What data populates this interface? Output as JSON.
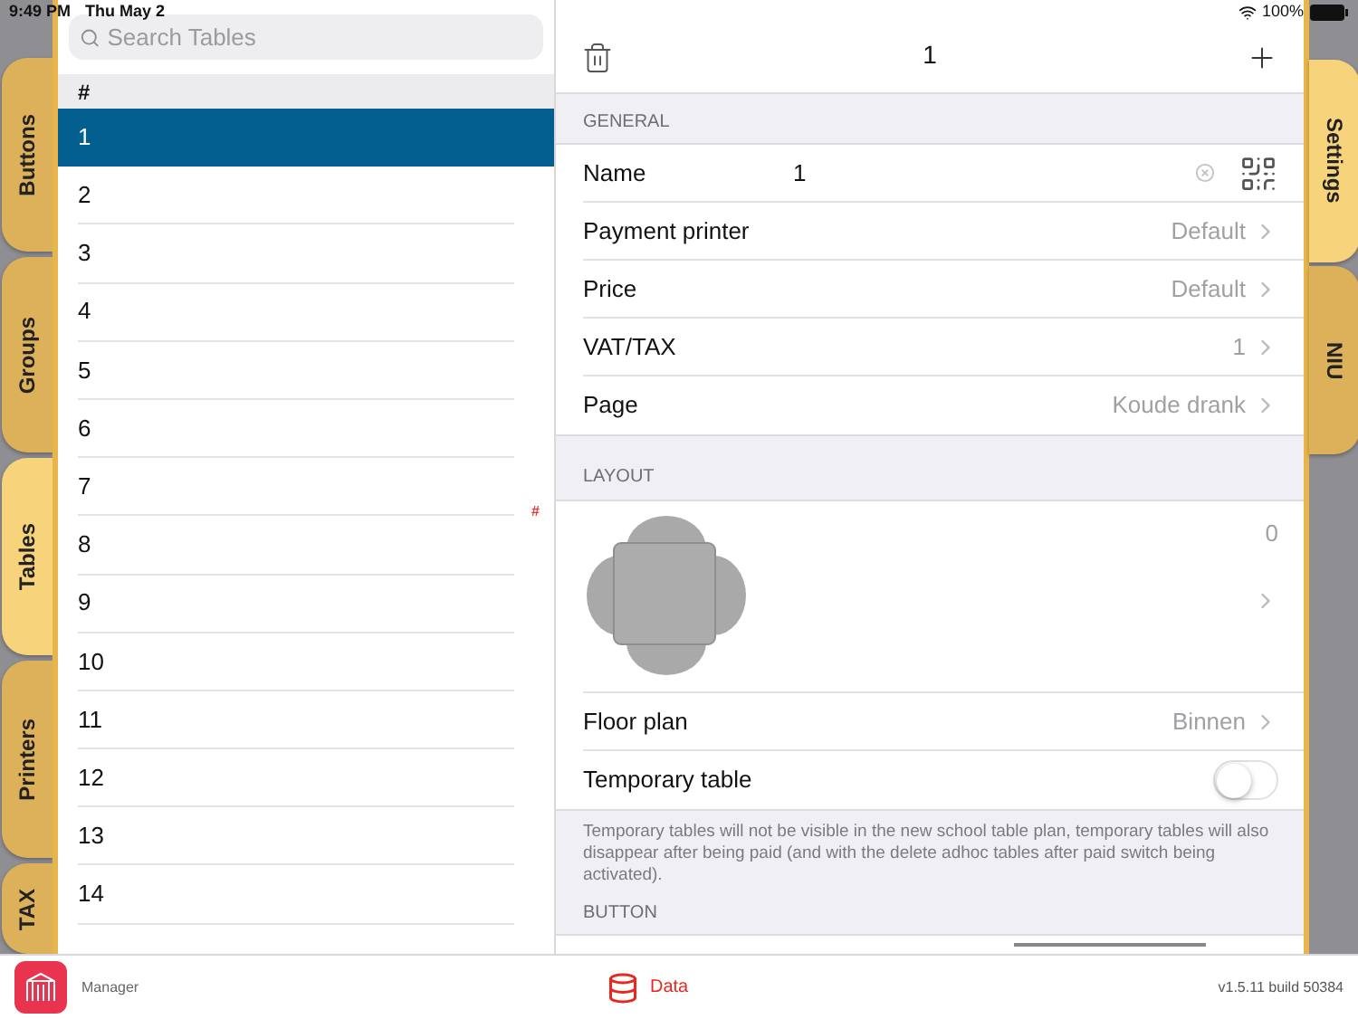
{
  "status_bar": {
    "time": "9:49 PM",
    "date": "Thu May 2",
    "battery": "100%"
  },
  "left_tabs": [
    {
      "label": "Buttons",
      "selected": false
    },
    {
      "label": "Groups",
      "selected": false
    },
    {
      "label": "Tables",
      "selected": true
    },
    {
      "label": "Printers",
      "selected": false
    },
    {
      "label": "TAX",
      "selected": false
    }
  ],
  "right_tabs": [
    {
      "label": "Settings",
      "selected": true
    },
    {
      "label": "NIU",
      "selected": false
    }
  ],
  "search": {
    "placeholder": "Search Tables"
  },
  "table_list": {
    "header": "#",
    "index_marker": "#",
    "rows": [
      {
        "label": "1",
        "selected": true
      },
      {
        "label": "2",
        "selected": false
      },
      {
        "label": "3",
        "selected": false
      },
      {
        "label": "4",
        "selected": false
      },
      {
        "label": "5",
        "selected": false
      },
      {
        "label": "6",
        "selected": false
      },
      {
        "label": "7",
        "selected": false
      },
      {
        "label": "8",
        "selected": false
      },
      {
        "label": "9",
        "selected": false
      },
      {
        "label": "10",
        "selected": false
      },
      {
        "label": "11",
        "selected": false
      },
      {
        "label": "12",
        "selected": false
      },
      {
        "label": "13",
        "selected": false
      },
      {
        "label": "14",
        "selected": false
      }
    ]
  },
  "detail": {
    "title": "1",
    "general": {
      "header": "GENERAL",
      "name_label": "Name",
      "name_value": "1",
      "rows": [
        {
          "label": "Payment printer",
          "value": "Default"
        },
        {
          "label": "Price",
          "value": "Default"
        },
        {
          "label": "VAT/TAX",
          "value": "1"
        },
        {
          "label": "Page",
          "value": "Koude drank"
        }
      ]
    },
    "layout": {
      "header": "LAYOUT",
      "count": "0",
      "floor_plan_label": "Floor plan",
      "floor_plan_value": "Binnen",
      "temporary_label": "Temporary table",
      "temporary_on": false,
      "note": "Temporary tables will not be visible in the new school table plan, temporary tables will also disappear after being paid (and with the delete adhoc tables after paid switch being activated)."
    },
    "button_header": "BUTTON"
  },
  "bottom_bar": {
    "app_name": "Manager",
    "data_label": "Data",
    "version": "v1.5.11 build 50384"
  }
}
